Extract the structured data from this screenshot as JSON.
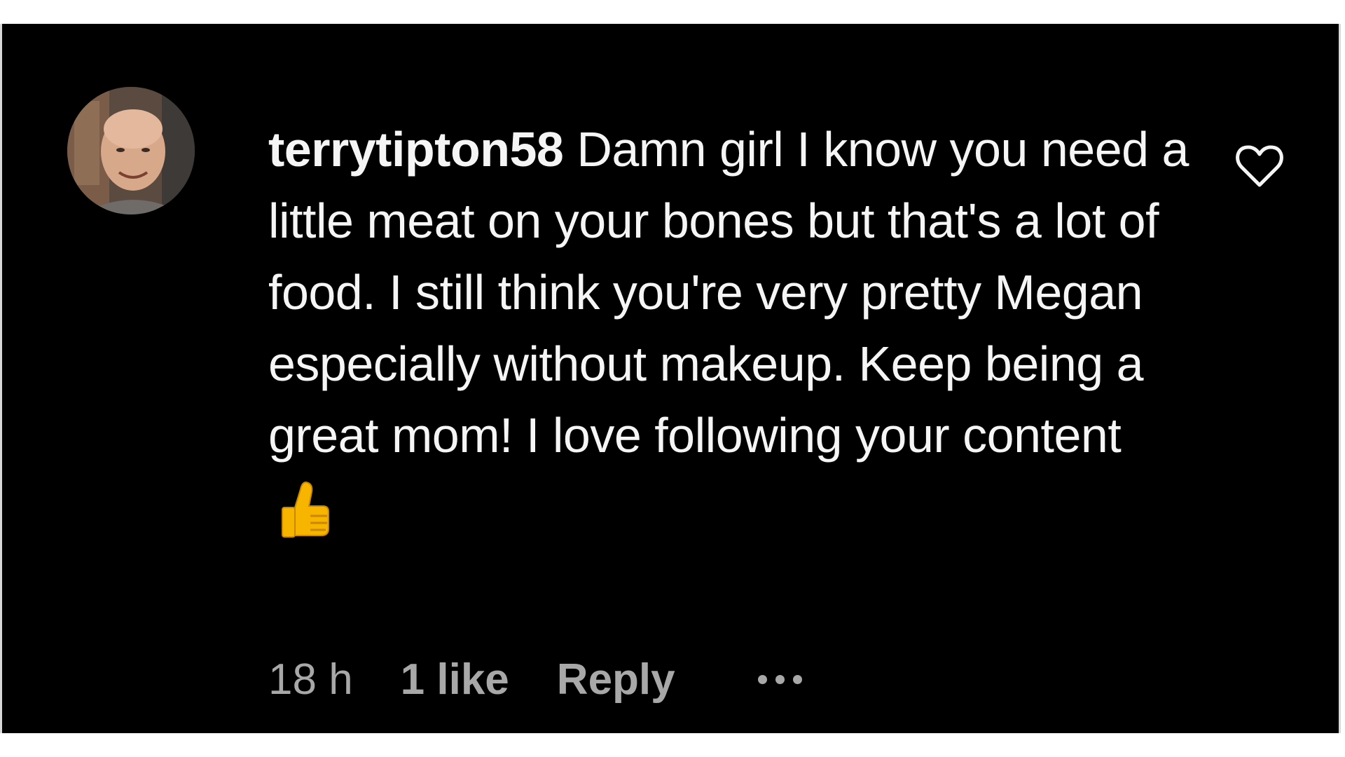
{
  "comment": {
    "username": "terrytipton58",
    "text": "Damn girl I know you need a little meat on your bones but that's a lot of food. I still think you're very pretty Megan especially without makeup. Keep being a great mom! I love following your content",
    "emoji": "👍"
  },
  "meta": {
    "time": "18 h",
    "likes": "1 like",
    "reply_label": "Reply"
  },
  "icons": {
    "like": "heart-outline-icon",
    "more": "more-options-icon",
    "avatar": "profile-photo"
  },
  "colors": {
    "background": "#000000",
    "text": "#f5f5f5",
    "muted": "#a8a8a8"
  }
}
